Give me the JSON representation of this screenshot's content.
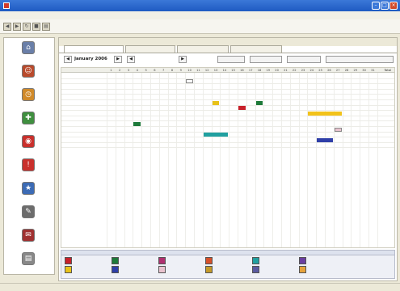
{
  "window": {
    "title": ""
  },
  "menu": [
    "",
    "",
    "",
    ""
  ],
  "toolbar": {
    "links": [
      {
        "label": "",
        "color": "blue"
      },
      {
        "label": "",
        "color": "green"
      },
      {
        "label": "",
        "color": "green"
      },
      {
        "label": "",
        "color": "red"
      },
      {
        "label": "",
        "color": "blue"
      },
      {
        "label": "",
        "color": "blue"
      },
      {
        "label": "",
        "color": "blue"
      }
    ],
    "right_links": [
      "",
      ""
    ]
  },
  "sidebar": {
    "items": [
      {
        "label": "",
        "icon": "home-icon",
        "color": "#6a7fa8"
      },
      {
        "label": "",
        "icon": "employees-icon",
        "color": "#b94a2c"
      },
      {
        "label": "",
        "icon": "attendance-icon",
        "color": "#d08a2a"
      },
      {
        "label": "",
        "icon": "professional-icon",
        "color": "#3f8f3f"
      },
      {
        "label": "",
        "icon": "schedule-icon",
        "color": "#c9302c"
      },
      {
        "label": "",
        "icon": "incidents-icon",
        "color": "#c9302c"
      },
      {
        "label": "",
        "icon": "accomplishments-icon",
        "color": "#3c6bb5"
      },
      {
        "label": "",
        "icon": "training-icon",
        "color": "#6c6c6c"
      },
      {
        "label": "",
        "icon": "recruitment-icon",
        "color": "#a03030"
      },
      {
        "label": "",
        "icon": "reports-icon",
        "color": "#888888"
      }
    ]
  },
  "main": {
    "header_hint": "",
    "tabs": [
      {
        "label": "",
        "active": true
      },
      {
        "label": "",
        "active": false
      },
      {
        "label": "",
        "active": false
      },
      {
        "label": "",
        "active": false
      }
    ],
    "controls": {
      "month": "January 2006",
      "filter": "",
      "buttons": [
        "",
        "",
        "",
        ""
      ]
    }
  },
  "calendar": {
    "name_header": "",
    "total_header": "Total",
    "days": [
      "1",
      "2",
      "3",
      "4",
      "5",
      "6",
      "7",
      "8",
      "9",
      "10",
      "11",
      "12",
      "13",
      "14",
      "15",
      "16",
      "17",
      "18",
      "19",
      "20",
      "21",
      "22",
      "23",
      "24",
      "25",
      "26",
      "27",
      "28",
      "29",
      "30",
      "31"
    ],
    "rows": [
      {
        "name": "",
        "total": ""
      },
      {
        "name": "",
        "total": ""
      },
      {
        "name": "",
        "total": ""
      },
      {
        "name": "",
        "total": ""
      },
      {
        "name": "",
        "total": ""
      },
      {
        "name": "",
        "total": ""
      },
      {
        "name": "",
        "total": ""
      },
      {
        "name": "",
        "total": ""
      },
      {
        "name": "",
        "total": ""
      },
      {
        "name": "",
        "total": ""
      },
      {
        "name": "",
        "total": ""
      },
      {
        "name": "",
        "total": ""
      },
      {
        "name": "",
        "total": ""
      },
      {
        "name": "",
        "total": ""
      }
    ],
    "entries": [
      {
        "row": 1,
        "start": 10,
        "end": 10,
        "color": "#ffffff",
        "outline": true
      },
      {
        "row": 5,
        "start": 13,
        "end": 13,
        "color": "#e8c21a"
      },
      {
        "row": 5,
        "start": 18,
        "end": 18,
        "color": "#1e7a3a"
      },
      {
        "row": 6,
        "start": 16,
        "end": 16,
        "color": "#c8202a"
      },
      {
        "row": 7,
        "start": 24,
        "end": 27,
        "color": "#f2c21a"
      },
      {
        "row": 9,
        "start": 4,
        "end": 4,
        "color": "#1e7a3a"
      },
      {
        "row": 10,
        "start": 27,
        "end": 27,
        "color": "#e9c3cf",
        "outline": true
      },
      {
        "row": 11,
        "start": 12,
        "end": 14,
        "color": "#21a0a0"
      },
      {
        "row": 12,
        "start": 25,
        "end": 26,
        "color": "#2f3fa8"
      }
    ]
  },
  "legend": {
    "tabs": [
      "",
      ""
    ],
    "items": [
      {
        "label": "",
        "color": "#c8202a"
      },
      {
        "label": "",
        "color": "#e8c21a"
      },
      {
        "label": "",
        "color": "#1e7a3a"
      },
      {
        "label": "",
        "color": "#2f3fa8"
      },
      {
        "label": "",
        "color": "#b03070"
      },
      {
        "label": "",
        "color": "#e9c3cf"
      },
      {
        "label": "",
        "color": "#d6502a"
      },
      {
        "label": "",
        "color": "#c49a2a"
      },
      {
        "label": "",
        "color": "#21a0a0"
      },
      {
        "label": "",
        "color": "#5a5aa0"
      },
      {
        "label": "",
        "color": "#6b3fa0"
      },
      {
        "label": "",
        "color": "#e6a23a"
      }
    ],
    "note": ""
  },
  "status": {
    "text": ""
  }
}
